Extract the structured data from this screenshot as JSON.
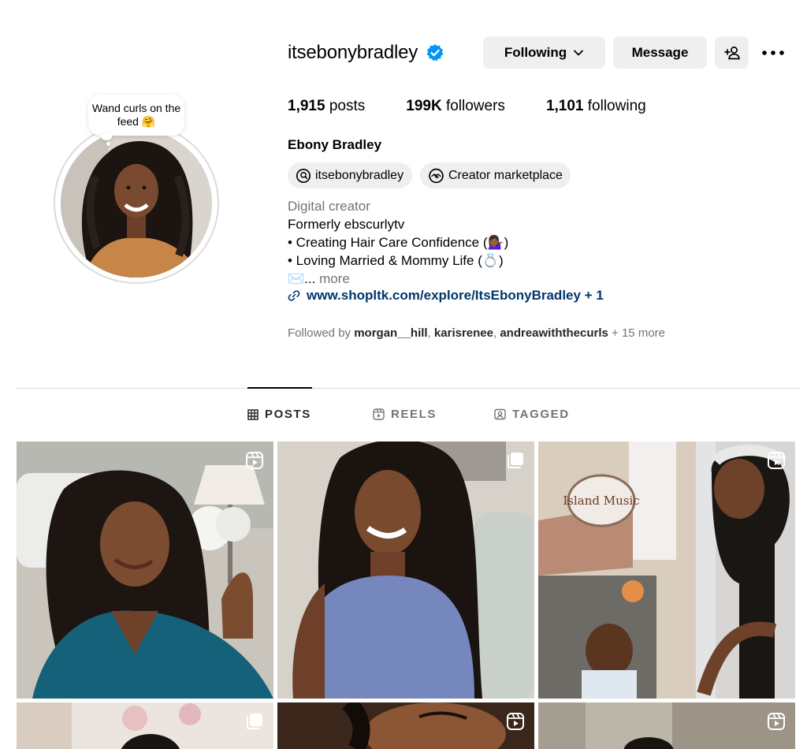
{
  "story_note": {
    "text": "Wand curls on the feed 🤗"
  },
  "profile": {
    "username": "itsebonybradley",
    "verified": true,
    "full_name": "Ebony Bradley",
    "avatar_icon": "profile-photo"
  },
  "actions": {
    "following_label": "Following",
    "message_label": "Message",
    "add_user_icon": "person-plus-icon",
    "more_icon": "three-dots-icon"
  },
  "stats": {
    "posts_count": "1,915",
    "posts_label": "posts",
    "followers_count": "199K",
    "followers_label": "followers",
    "following_count": "1,101",
    "following_label": "following"
  },
  "chips": {
    "threads_label": "itsebonybradley",
    "marketplace_label": "Creator marketplace"
  },
  "bio": {
    "category": "Digital creator",
    "line1": "Formerly ebscurlytv",
    "line2": "• Creating Hair Care Confidence (💁🏾‍♀️)",
    "line3": "• Loving Married & Mommy Life (💍)",
    "line4_prefix": "✉️...",
    "more_label": " more",
    "link": "www.shopltk.com/explore/ItsEbonyBradley + 1"
  },
  "followed_by": {
    "prefix": "Followed by ",
    "users": [
      "morgan__hill",
      "karisrenee",
      "andreawiththecurls"
    ],
    "suffix": " + 15 more"
  },
  "tabs": [
    {
      "label": "POSTS",
      "icon": "grid-icon",
      "active": true
    },
    {
      "label": "REELS",
      "icon": "reels-icon",
      "active": false
    },
    {
      "label": "TAGGED",
      "icon": "tagged-icon",
      "active": false
    }
  ],
  "grid": [
    {
      "type": "reel",
      "desc": "woman with wand curls in teal robe"
    },
    {
      "type": "carousel",
      "desc": "woman with long twists in blue top"
    },
    {
      "type": "reel",
      "desc": "mother and baby outside Island Music shop"
    },
    {
      "type": "carousel"
    },
    {
      "type": "reel"
    },
    {
      "type": "reel"
    }
  ],
  "sign_text": {
    "shop": "Island Music"
  },
  "colors": {
    "verified_blue": "#0095f6",
    "link_blue": "#00376b",
    "button_gray": "#efefef",
    "muted_text": "#737373"
  }
}
